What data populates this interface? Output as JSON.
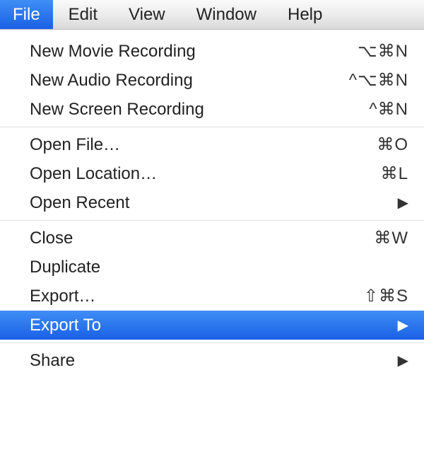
{
  "menubar": {
    "items": [
      {
        "label": "File",
        "selected": true
      },
      {
        "label": "Edit"
      },
      {
        "label": "View"
      },
      {
        "label": "Window"
      },
      {
        "label": "Help"
      }
    ]
  },
  "dropdown": {
    "groups": [
      [
        {
          "label": "New Movie Recording",
          "shortcut": "⌥⌘N"
        },
        {
          "label": "New Audio Recording",
          "shortcut": "^⌥⌘N"
        },
        {
          "label": "New Screen Recording",
          "shortcut": "^⌘N"
        }
      ],
      [
        {
          "label": "Open File…",
          "shortcut": "⌘O"
        },
        {
          "label": "Open Location…",
          "shortcut": "⌘L"
        },
        {
          "label": "Open Recent",
          "submenu": true
        }
      ],
      [
        {
          "label": "Close",
          "shortcut": "⌘W"
        },
        {
          "label": "Duplicate"
        },
        {
          "label": "Export…",
          "shortcut": "⇧⌘S"
        },
        {
          "label": "Export To",
          "submenu": true,
          "highlighted": true
        }
      ],
      [
        {
          "label": "Share",
          "submenu": true
        }
      ]
    ]
  },
  "glyphs": {
    "submenu_arrow": "▶"
  }
}
